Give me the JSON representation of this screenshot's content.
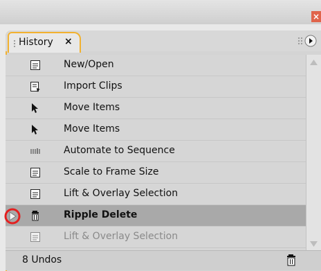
{
  "panel": {
    "tab_label": "History",
    "tab_close": "×",
    "footer_status": "8 Undos"
  },
  "history_items": [
    {
      "label": "New/Open",
      "icon": "list-icon",
      "state": "done"
    },
    {
      "label": "Import Clips",
      "icon": "import-icon",
      "state": "done"
    },
    {
      "label": "Move Items",
      "icon": "arrow-cursor-icon",
      "state": "done"
    },
    {
      "label": "Move Items",
      "icon": "arrow-cursor-icon",
      "state": "done"
    },
    {
      "label": "Automate to Sequence",
      "icon": "sequence-icon",
      "state": "done"
    },
    {
      "label": "Scale to Frame Size",
      "icon": "list-icon",
      "state": "done"
    },
    {
      "label": "Lift & Overlay Selection",
      "icon": "list-icon",
      "state": "done"
    },
    {
      "label": "Ripple Delete",
      "icon": "trash-icon",
      "state": "current"
    },
    {
      "label": "Lift & Overlay Selection",
      "icon": "list-icon",
      "state": "undone"
    }
  ],
  "colors": {
    "tab_border": "#f2b12f",
    "selected_row": "#a9a9a9",
    "marker_ring": "#e32020",
    "close_button": "#e0644b"
  }
}
